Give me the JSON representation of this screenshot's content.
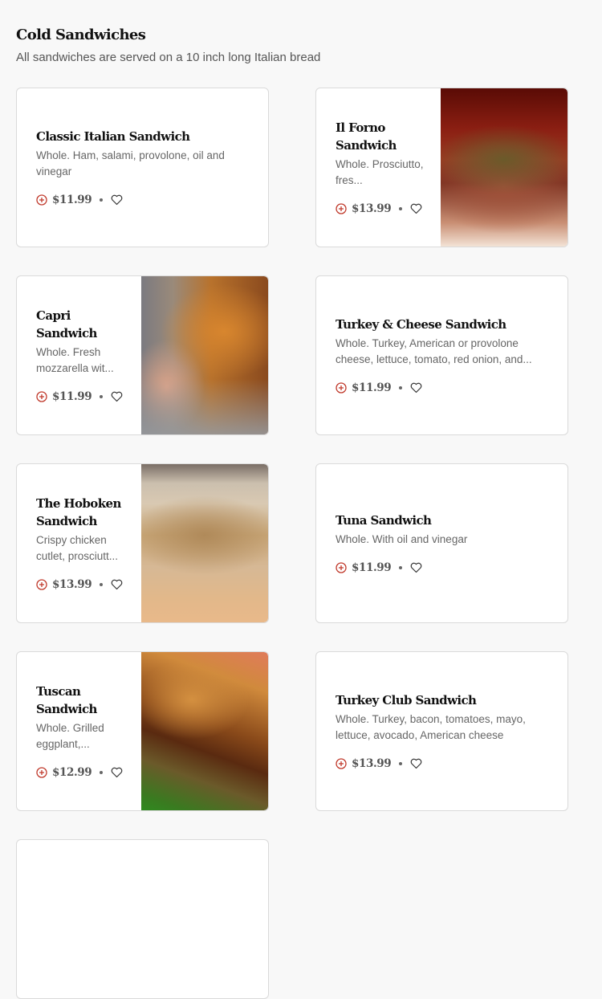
{
  "section": {
    "title": "Cold Sandwiches",
    "subtitle": "All sandwiches are served on a 10 inch long Italian bread"
  },
  "colors": {
    "add_icon": "#c0392b",
    "price_text": "#555555",
    "card_border": "#dadada"
  },
  "items": [
    {
      "name": "Classic Italian Sandwich",
      "description": "Whole. Ham, salami, provolone, oil and vinegar",
      "price": "$11.99",
      "has_image": false
    },
    {
      "name": "Il Forno Sandwich",
      "description": "Whole. Prosciutto, fres...",
      "price": "$13.99",
      "has_image": true
    },
    {
      "name": "Capri Sandwich",
      "description": "Whole. Fresh mozzarella wit...",
      "price": "$11.99",
      "has_image": true
    },
    {
      "name": "Turkey & Cheese Sandwich",
      "description": "Whole. Turkey, American or provolone cheese, lettuce, tomato, red onion, and...",
      "price": "$11.99",
      "has_image": false
    },
    {
      "name": "The Hoboken Sandwich",
      "description": "Crispy chicken cutlet, prosciutt...",
      "price": "$13.99",
      "has_image": true
    },
    {
      "name": "Tuna Sandwich",
      "description": "Whole. With oil and vinegar",
      "price": "$11.99",
      "has_image": false
    },
    {
      "name": "Tuscan Sandwich",
      "description": "Whole. Grilled eggplant,...",
      "price": "$12.99",
      "has_image": true
    },
    {
      "name": "Turkey Club Sandwich",
      "description": "Whole. Turkey, bacon, tomatoes, mayo, lettuce, avocado, American cheese",
      "price": "$13.99",
      "has_image": false
    }
  ],
  "icons": {
    "add": "plus-circle-icon",
    "favorite": "heart-icon"
  }
}
